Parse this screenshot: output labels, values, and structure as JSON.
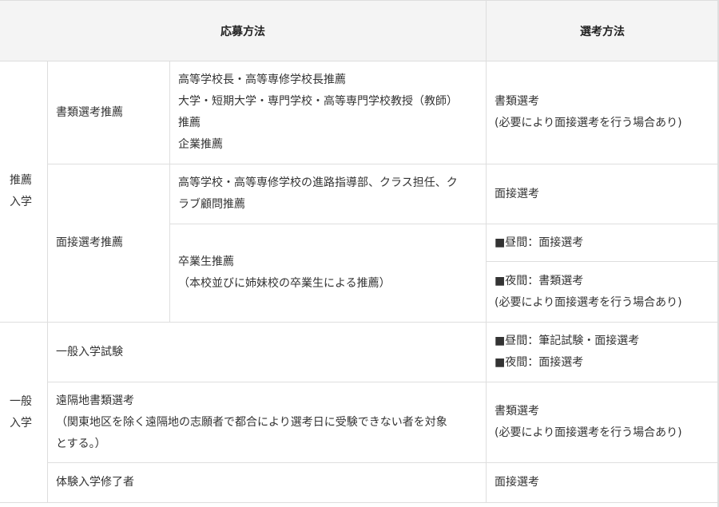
{
  "header": {
    "application": "応募方法",
    "selection": "選考方法"
  },
  "suisen": {
    "category": [
      "推薦",
      "入学"
    ],
    "shorui": {
      "label": "書類選考推薦",
      "recommenders": [
        "高等学校長・高等専修学校長推薦",
        "大学・短期大学・専門学校・高等専門学校教授（教師）",
        "推薦",
        "企業推薦"
      ],
      "method": [
        "書類選考",
        "(必要により面接選考を行う場合あり)"
      ]
    },
    "mensetsu": {
      "label": "面接選考推薦",
      "recommenders": [
        "高等学校・高等専修学校の進路指導部、クラス担任、ク",
        "ラブ顧問推薦"
      ],
      "method": "面接選考",
      "alumni": [
        "卒業生推薦",
        "（本校並びに姉妹校の卒業生による推薦）"
      ],
      "alumni_day": "■昼間：面接選考",
      "alumni_night": [
        "■夜間：書類選考",
        "(必要により面接選考を行う場合あり)"
      ]
    }
  },
  "ippan": {
    "category": [
      "一般",
      "入学"
    ],
    "exam": {
      "label": "一般入学試験",
      "method": [
        "■昼間：筆記試験・面接選考",
        "■夜間：面接選考"
      ]
    },
    "remote": {
      "label": [
        "遠隔地書類選考",
        "（関東地区を除く遠隔地の志願者で都合により選考日に受験できない者を対象",
        "とする。）"
      ],
      "method": [
        "書類選考",
        "(必要により面接選考を行う場合あり)"
      ]
    },
    "trial": {
      "label": "体験入学修了者",
      "method": "面接選考"
    }
  }
}
